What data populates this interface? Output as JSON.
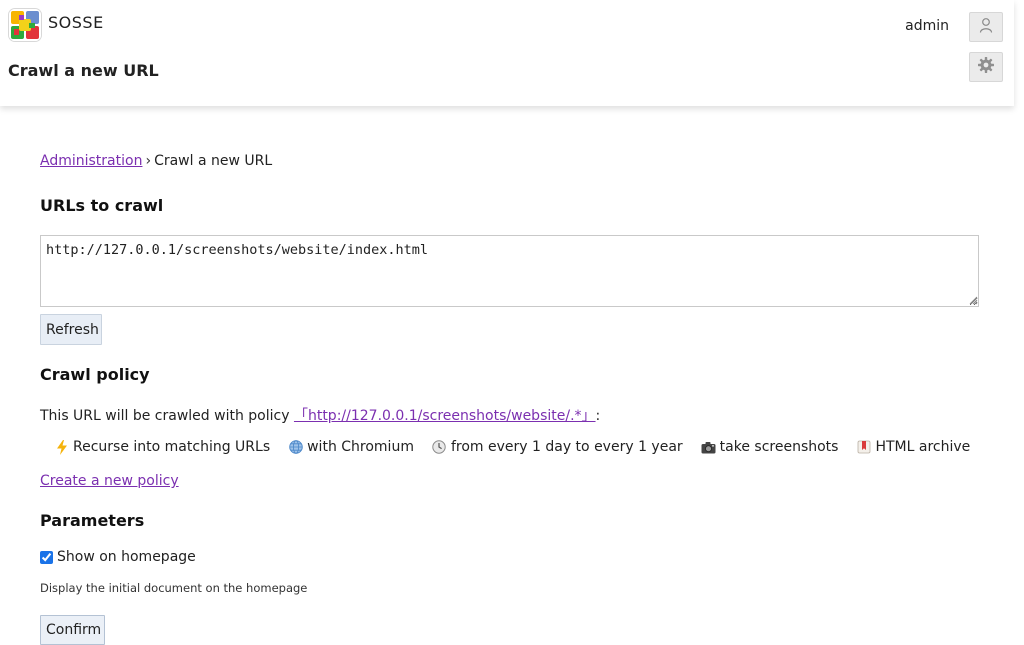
{
  "app": {
    "name": "SOSSE"
  },
  "header": {
    "page_title": "Crawl a new URL",
    "username": "admin"
  },
  "breadcrumb": {
    "parent": "Administration",
    "separator": "›",
    "current": "Crawl a new URL"
  },
  "urls_section": {
    "heading": "URLs to crawl",
    "value": "http://127.0.0.1/screenshots/website/index.html",
    "refresh_label": "Refresh"
  },
  "policy_section": {
    "heading": "Crawl policy",
    "intro": "This URL will be crawled with policy",
    "policy_link": "「http://127.0.0.1/screenshots/website/.*」",
    "suffix": ":",
    "features": [
      {
        "icon": "lightning-icon",
        "label": "Recurse into matching URLs"
      },
      {
        "icon": "globe-icon",
        "label": "with Chromium"
      },
      {
        "icon": "clock-icon",
        "label": "from every 1 day to every 1 year"
      },
      {
        "icon": "camera-icon",
        "label": "take screenshots"
      },
      {
        "icon": "bookmark-icon",
        "label": "HTML archive"
      }
    ],
    "create_link": "Create a new policy"
  },
  "params_section": {
    "heading": "Parameters",
    "show_on_homepage_label": "Show on homepage",
    "show_on_homepage_checked": true,
    "help_text": "Display the initial document on the homepage",
    "confirm_label": "Confirm"
  }
}
